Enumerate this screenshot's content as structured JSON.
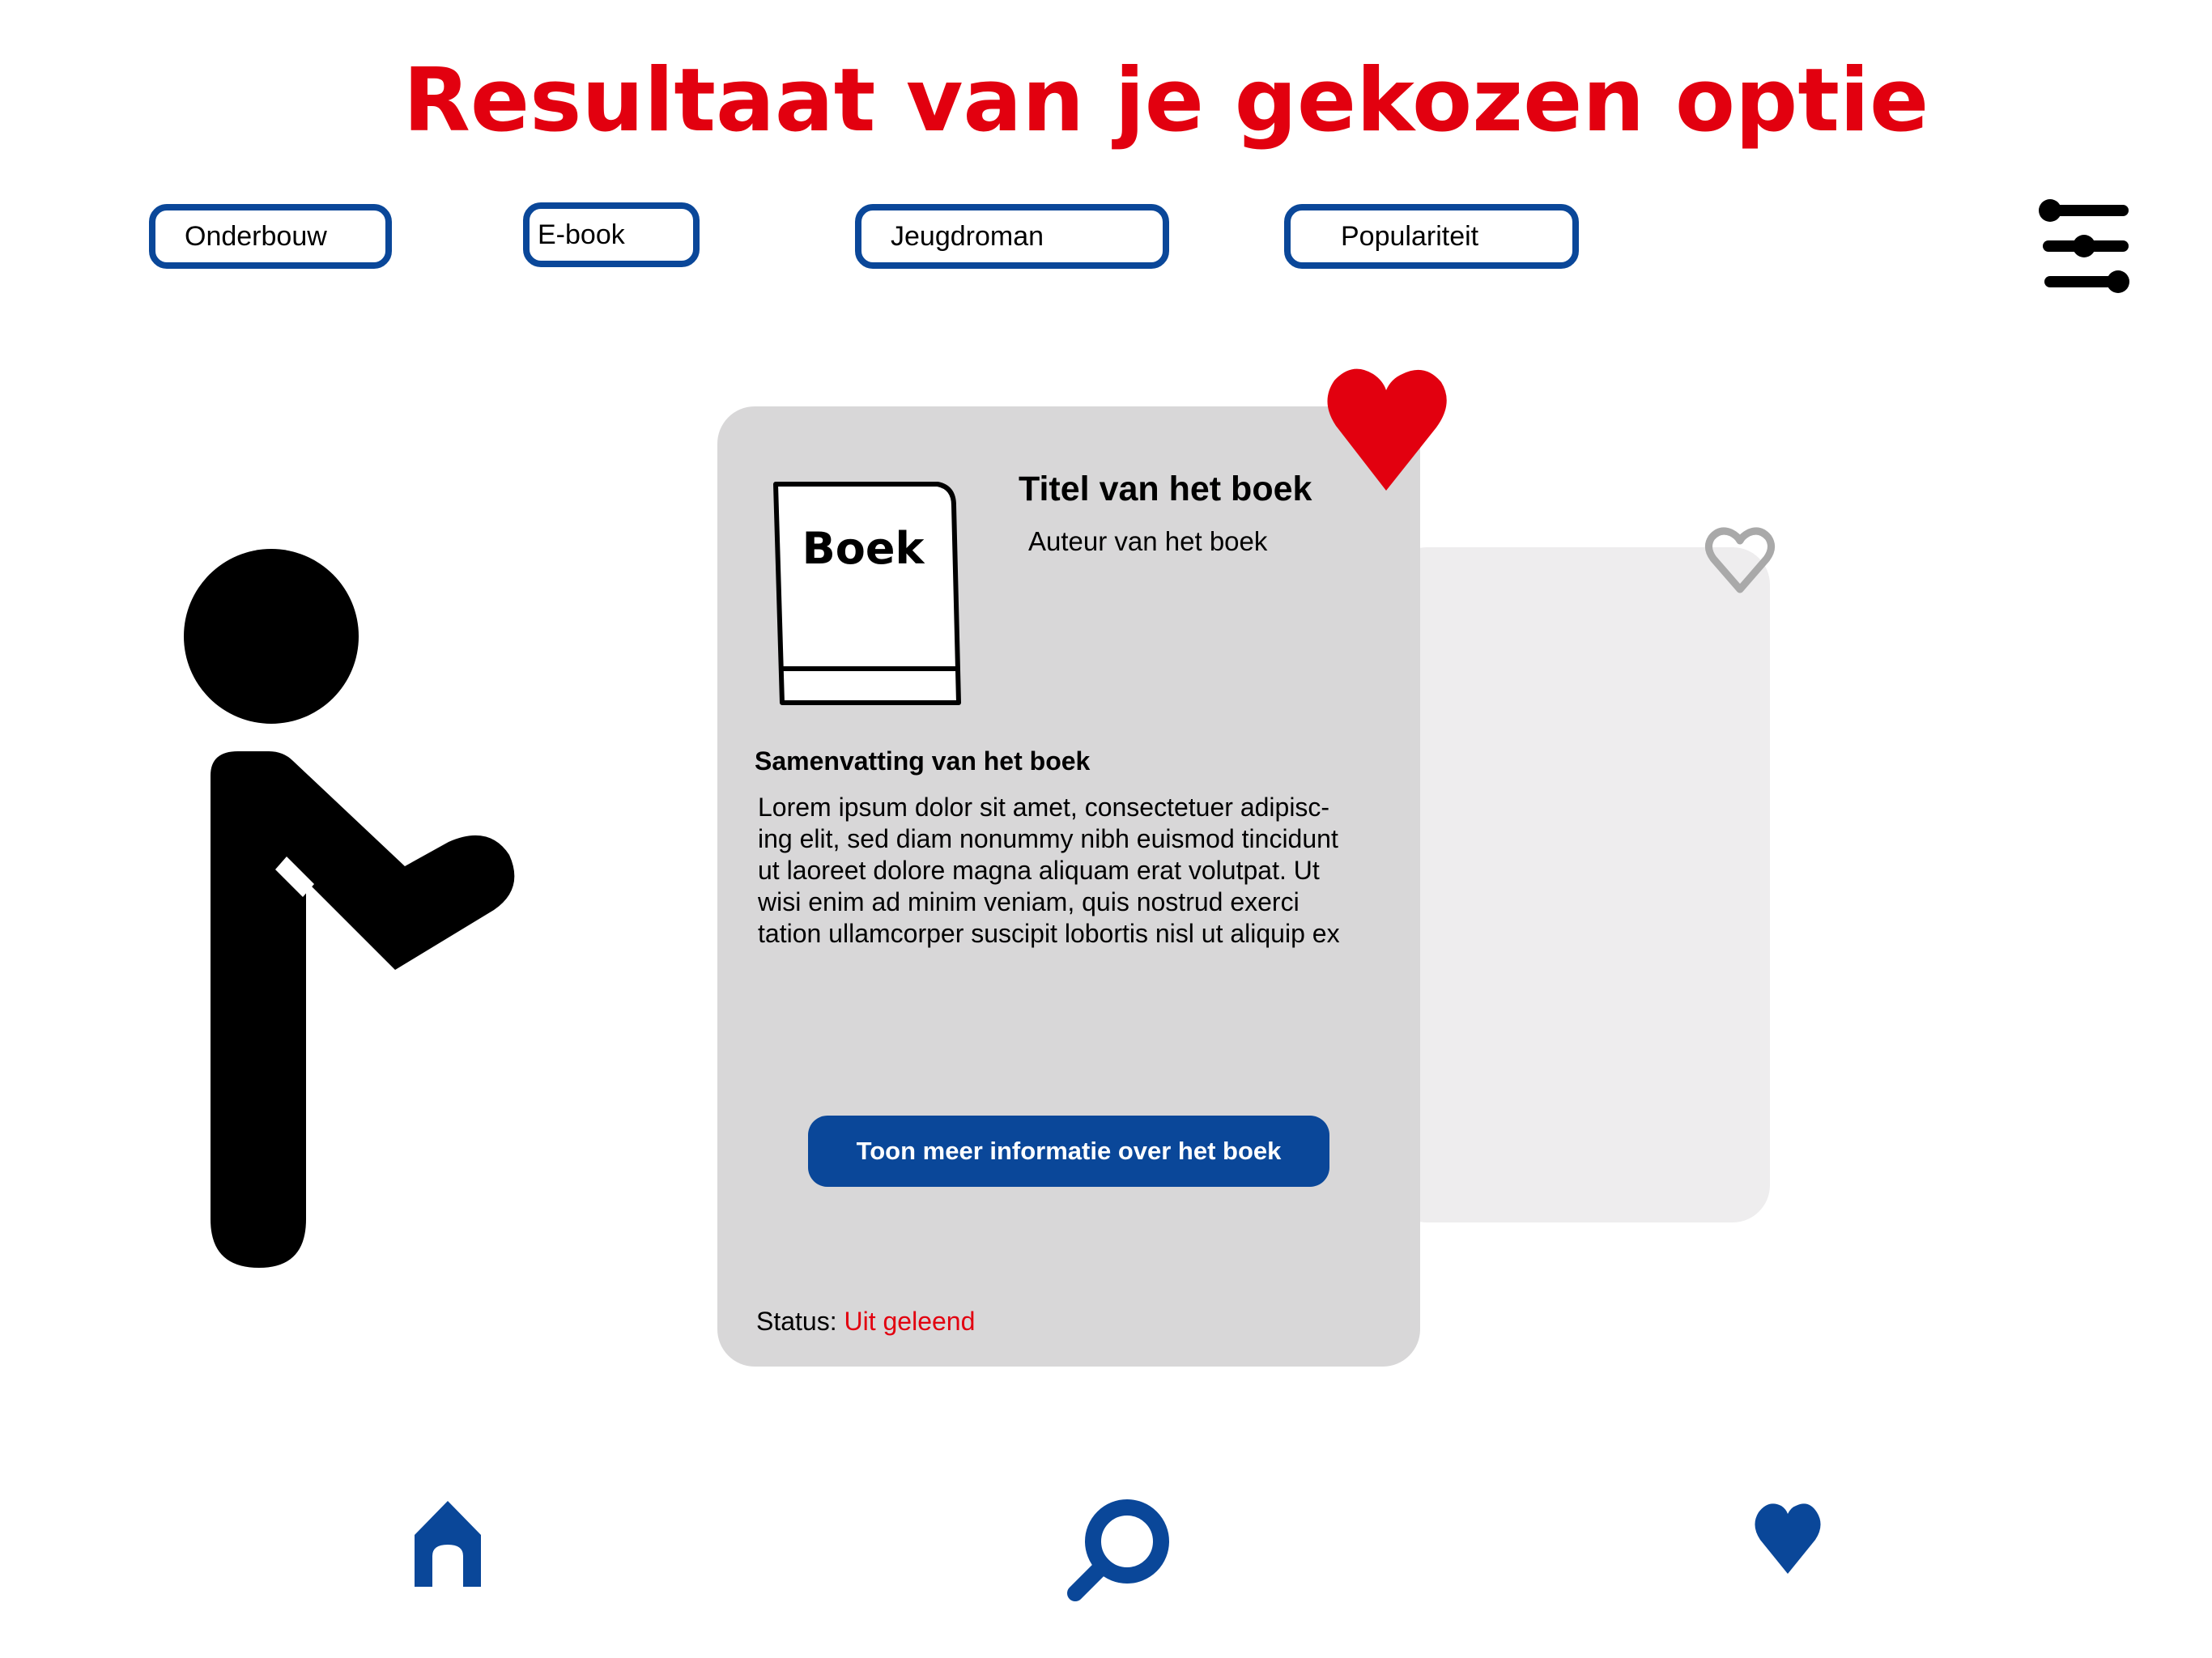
{
  "header": {
    "title": "Resultaat van je gekozen optie"
  },
  "filters": {
    "chips": [
      {
        "label": "Onderbouw"
      },
      {
        "label": "E-book"
      },
      {
        "label": "Jeugdroman"
      },
      {
        "label": "Populariteit"
      }
    ],
    "settings_icon": "sliders-icon"
  },
  "card": {
    "cover_text": "Boek",
    "title": "Titel van het boek",
    "author": "Auteur van het boek",
    "summary_heading": "Samenvatting van het boek",
    "summary_lines": [
      "Lorem ipsum dolor sit amet, consectetuer adipisc-",
      "ing elit, sed diam nonummy nibh euismod tincidunt",
      "ut laoreet dolore magna aliquam erat volutpat. Ut",
      "wisi enim ad minim veniam, quis nostrud exerci",
      "tation ullamcorper suscipit lobortis nisl ut aliquip ex"
    ],
    "more_button_label": "Toon meer informatie over het boek",
    "status_label": "Status:",
    "status_value": "Uit geleend",
    "favorite_icon": "heart-filled-icon"
  },
  "next_card": {
    "favorite_icon": "heart-outline-icon"
  },
  "bottom_nav": {
    "items": [
      {
        "icon": "home-icon"
      },
      {
        "icon": "search-icon"
      },
      {
        "icon": "heart-icon"
      }
    ]
  },
  "colors": {
    "accent_red": "#e2000f",
    "brand_blue": "#0a4799",
    "card_grey": "#d8d7d8",
    "card_back_grey": "#eeedee"
  }
}
